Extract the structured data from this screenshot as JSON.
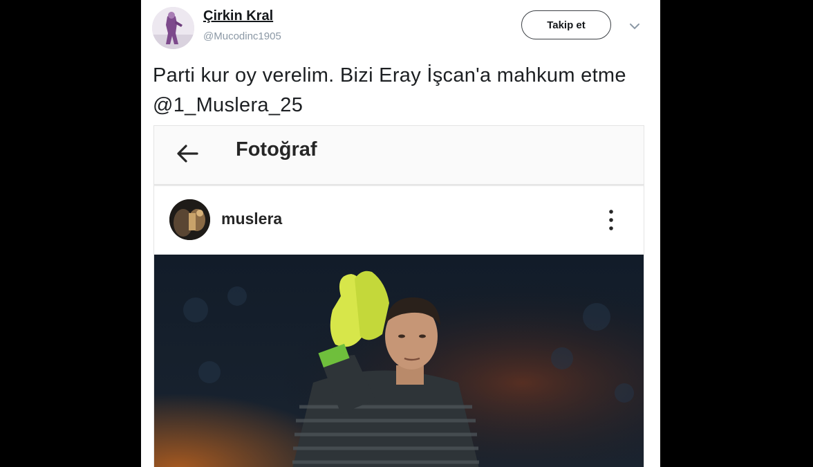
{
  "tweet": {
    "display_name": "Çirkin Kral",
    "handle": "@Mucodinc1905",
    "follow_label": "Takip et",
    "text": "Parti kur oy verelim. Bizi Eray İşcan'a mahkum etme ",
    "mention": "@1_Muslera_25",
    "caret_icon": "chevron-down-icon"
  },
  "embed": {
    "topbar": {
      "title": "Fotoğraf",
      "back_icon": "arrow-left-icon"
    },
    "post": {
      "username": "muslera",
      "more_icon": "vertical-dots-icon"
    }
  }
}
